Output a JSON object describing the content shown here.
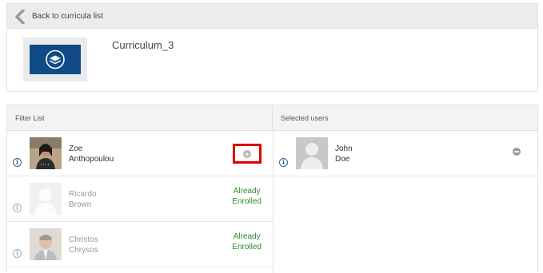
{
  "nav": {
    "back_label": "Back to curricula list"
  },
  "curriculum": {
    "title": "Curriculum_3"
  },
  "filter_list": {
    "header": "Filter List",
    "users": [
      {
        "first": "Zoe",
        "last": "Anthopoulou",
        "status": ""
      },
      {
        "first": "Ricardo",
        "last": "Brown",
        "status_line1": "Already",
        "status_line2": "Enrolled"
      },
      {
        "first": "Christos",
        "last": "Chrysos",
        "status_line1": "Already",
        "status_line2": "Enrolled"
      }
    ]
  },
  "selected_users": {
    "header": "Selected users",
    "users": [
      {
        "first": "John",
        "last": "Doe"
      }
    ]
  },
  "icons": {
    "back": "chevron-left-icon",
    "info": "info-icon",
    "add": "plus-circle-icon",
    "remove": "minus-circle-icon"
  },
  "colors": {
    "enrolled": "#2e8b2e",
    "highlight": "#e00000",
    "thumb_bg": "#0f4a87"
  }
}
